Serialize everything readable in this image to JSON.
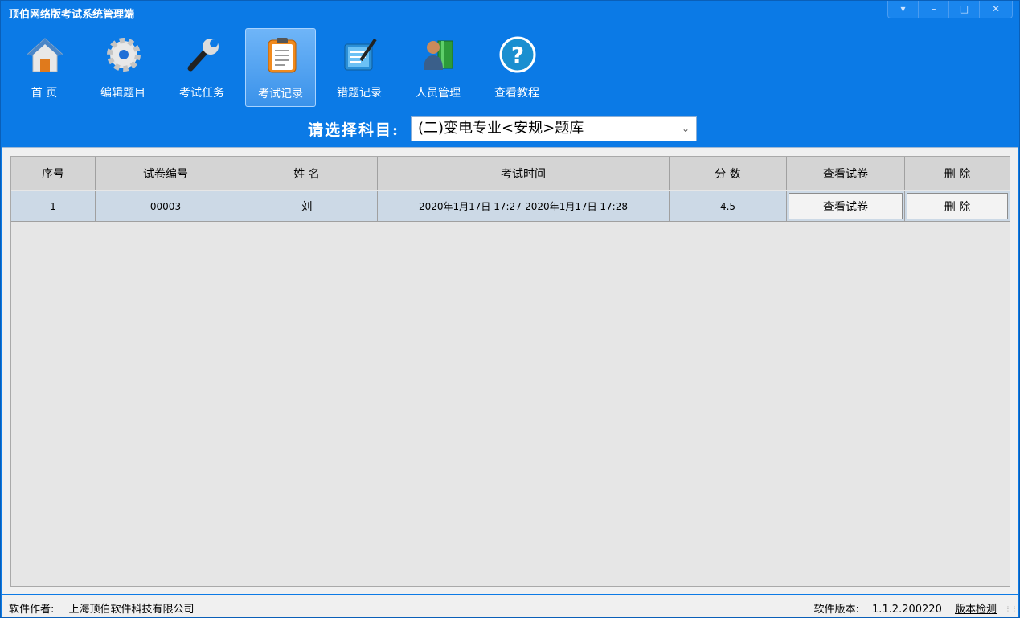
{
  "window": {
    "title": "顶伯网络版考试系统管理端",
    "controls": [
      "▾",
      "–",
      "□",
      "✕"
    ]
  },
  "toolbar": {
    "items": [
      {
        "label": "首  页",
        "icon": "home-icon"
      },
      {
        "label": "编辑题目",
        "icon": "gear-icon"
      },
      {
        "label": "考试任务",
        "icon": "wrench-icon"
      },
      {
        "label": "考试记录",
        "icon": "clipboard-icon",
        "active": true
      },
      {
        "label": "错题记录",
        "icon": "notebook-icon"
      },
      {
        "label": "人员管理",
        "icon": "user-icon"
      },
      {
        "label": "查看教程",
        "icon": "help-icon"
      }
    ]
  },
  "subject": {
    "label": "请选择科目:",
    "selected": "(二)变电专业<安规>题库"
  },
  "table": {
    "columns": [
      "序号",
      "试卷编号",
      "姓  名",
      "考试时间",
      "分  数",
      "查看试卷",
      "删  除"
    ],
    "rows": [
      {
        "index": "1",
        "paper_no": "00003",
        "name": "刘",
        "time": "2020年1月17日 17:27-2020年1月17日 17:28",
        "score": "4.5",
        "view_label": "查看试卷",
        "delete_label": "删  除"
      }
    ]
  },
  "status": {
    "author_label": "软件作者:",
    "author": "上海顶伯软件科技有限公司",
    "version_label": "软件版本:",
    "version": "1.1.2.200220",
    "check_link": "版本检测"
  },
  "colors": {
    "window_blue": "#0b7ae6",
    "active_button": "#4a9cef",
    "header_gray": "#d4d4d4",
    "row_blue": "#ccd9e6"
  }
}
